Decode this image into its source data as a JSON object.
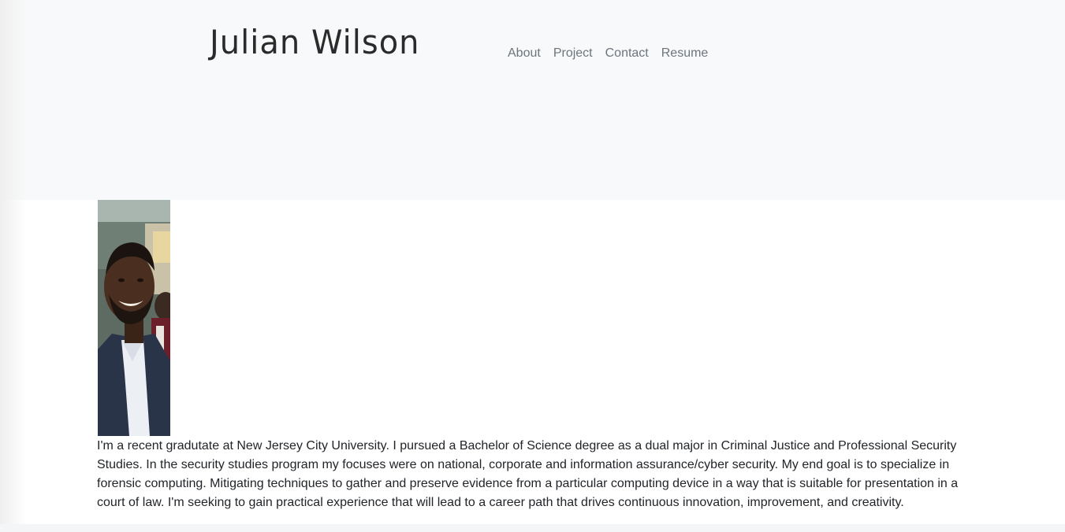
{
  "header": {
    "brand": "Julian Wilson",
    "nav": [
      "About",
      "Project",
      "Contact",
      "Resume"
    ]
  },
  "about": {
    "photo_alt": "Portrait photo",
    "bio": "I'm a recent gradutate at New Jersey City University. I pursued a Bachelor of Science degree as a dual major in Criminal Justice and Professional Security Studies. In the security studies program my focuses were on national, corporate and information assurance/cyber security. My end goal is to specialize in forensic computing. Mitigating techniques to gather and preserve evidence from a particular computing device in a way that is suitable for presentation in a court of law. I'm seeking to gain practical experience that will lead to a career path that drives continuous innovation, improvement, and creativity."
  },
  "colors": {
    "header_bg": "#f8f9fa",
    "nav_link": "#6c757d",
    "text": "#212529"
  }
}
